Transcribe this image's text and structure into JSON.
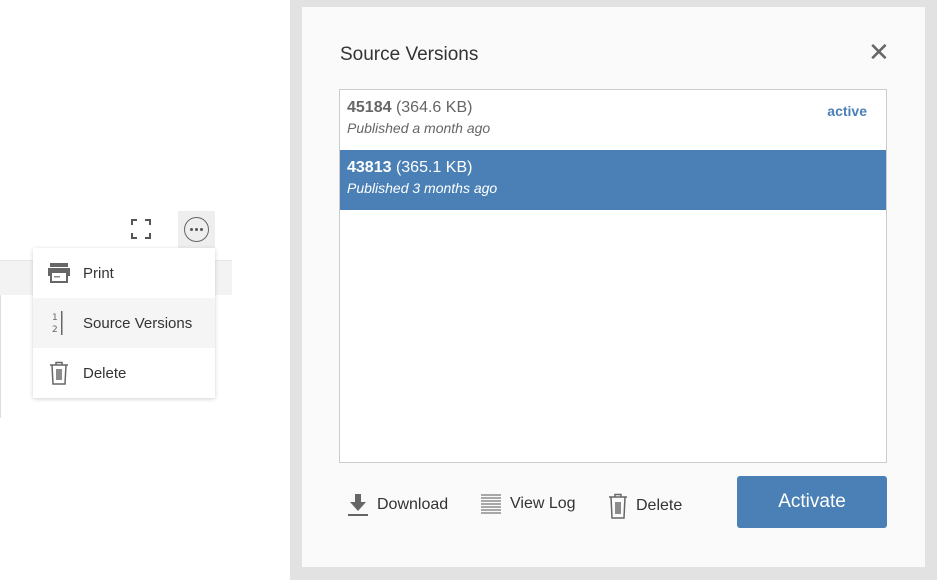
{
  "menu": {
    "items": [
      {
        "label": "Print",
        "icon": "printer-icon"
      },
      {
        "label": "Source Versions",
        "icon": "versions-icon"
      },
      {
        "label": "Delete",
        "icon": "trash-icon"
      }
    ]
  },
  "modal": {
    "title": "Source Versions",
    "versions": [
      {
        "id": "45184",
        "size": "(364.6 KB)",
        "published": "Published a month ago",
        "badge": "active",
        "selected": false
      },
      {
        "id": "43813",
        "size": "(365.1 KB)",
        "published": "Published 3 months ago",
        "selected": true
      }
    ],
    "actions": {
      "download": "Download",
      "view_log": "View Log",
      "delete": "Delete",
      "activate": "Activate"
    }
  },
  "colors": {
    "accent": "#4a80b5"
  }
}
